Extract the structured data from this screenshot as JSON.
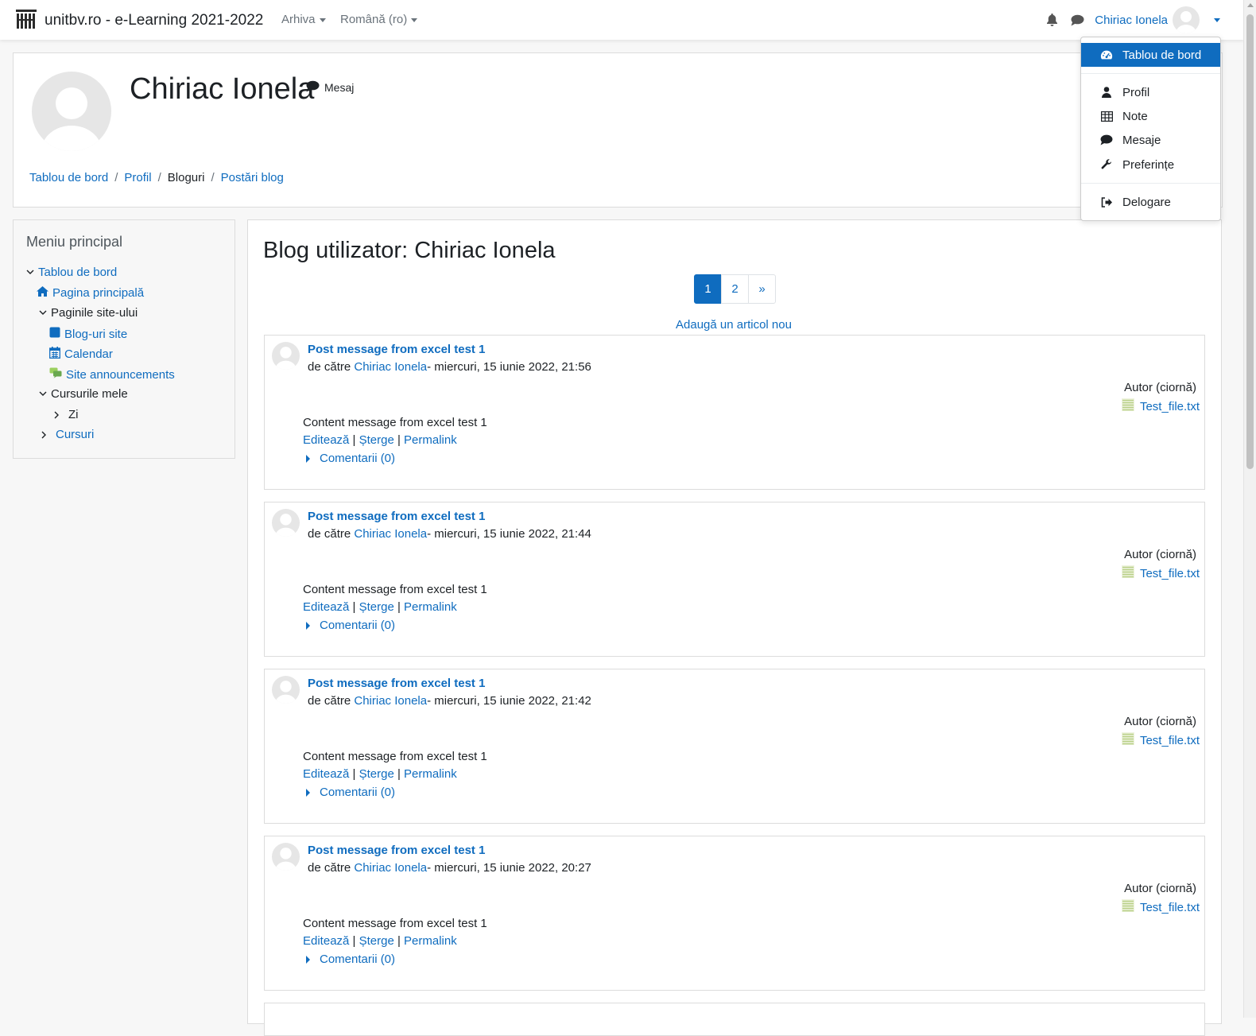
{
  "navbar": {
    "site_name": "unitbv.ro - e-Learning 2021-2022",
    "menu_archive": "Arhiva",
    "menu_language": "Română (ro)",
    "user_name": "Chiriac Ionela"
  },
  "user_menu": {
    "items": [
      {
        "label": "Tablou de bord",
        "icon": "dashboard-icon"
      },
      {
        "label": "Profil",
        "icon": "user-icon"
      },
      {
        "label": "Note",
        "icon": "table-icon"
      },
      {
        "label": "Mesaje",
        "icon": "comment-icon"
      },
      {
        "label": "Preferințe",
        "icon": "wrench-icon"
      },
      {
        "label": "Delogare",
        "icon": "sign-out-icon"
      }
    ]
  },
  "header": {
    "user_fullname": "Chiriac Ionela",
    "message_label": "Mesaj",
    "breadcrumb": [
      "Tablou de bord",
      "Profil",
      "Bloguri",
      "Postări blog"
    ]
  },
  "sidebar": {
    "title": "Meniu principal",
    "items": [
      {
        "label": "Tablou de bord"
      },
      {
        "label": "Pagina principală"
      },
      {
        "label": "Paginile site-ului"
      },
      {
        "label": "Blog-uri site"
      },
      {
        "label": "Calendar"
      },
      {
        "label": "Site announcements"
      },
      {
        "label": "Cursurile mele"
      },
      {
        "label": "Zi"
      },
      {
        "label": "Cursuri"
      }
    ]
  },
  "main": {
    "title": "Blog utilizator: Chiriac Ionela",
    "pagination": [
      "1",
      "2",
      "»"
    ],
    "current_page": 1,
    "add_entry": "Adaugă un articol nou",
    "posts": [
      {
        "title": "Post message from excel test 1",
        "by_prefix": "de către ",
        "author": "Chiriac Ionela",
        "date": "- miercuri, 15 iunie 2022, 21:56",
        "status": "Autor (ciornă)",
        "attachment": "Test_file.txt",
        "content": "Content message from excel test 1",
        "edit": "Editează",
        "delete": "Șterge",
        "permalink": "Permalink",
        "comments": "Comentarii (0)"
      },
      {
        "title": "Post message from excel test 1",
        "by_prefix": "de către ",
        "author": "Chiriac Ionela",
        "date": "- miercuri, 15 iunie 2022, 21:44",
        "status": "Autor (ciornă)",
        "attachment": "Test_file.txt",
        "content": "Content message from excel test 1",
        "edit": "Editează",
        "delete": "Șterge",
        "permalink": "Permalink",
        "comments": "Comentarii (0)"
      },
      {
        "title": "Post message from excel test 1",
        "by_prefix": "de către ",
        "author": "Chiriac Ionela",
        "date": "- miercuri, 15 iunie 2022, 21:42",
        "status": "Autor (ciornă)",
        "attachment": "Test_file.txt",
        "content": "Content message from excel test 1",
        "edit": "Editează",
        "delete": "Șterge",
        "permalink": "Permalink",
        "comments": "Comentarii (0)"
      },
      {
        "title": "Post message from excel test 1",
        "by_prefix": "de către ",
        "author": "Chiriac Ionela",
        "date": "- miercuri, 15 iunie 2022, 20:27",
        "status": "Autor (ciornă)",
        "attachment": "Test_file.txt",
        "content": "Content message from excel test 1",
        "edit": "Editează",
        "delete": "Șterge",
        "permalink": "Permalink",
        "comments": "Comentarii (0)"
      }
    ]
  },
  "colors": {
    "link": "#0f6cbf",
    "active_bg": "#0f6cbf",
    "text": "#1d2125"
  }
}
